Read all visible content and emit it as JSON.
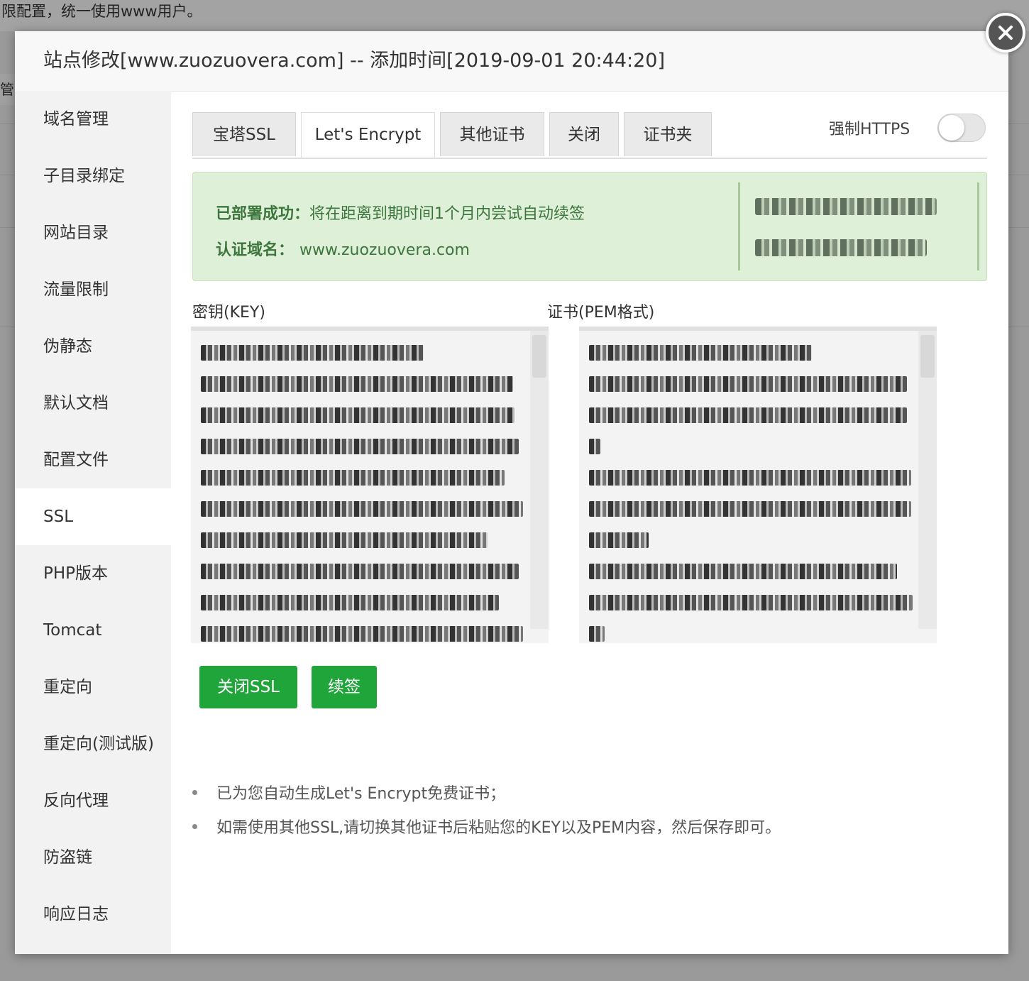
{
  "background": {
    "top_text": "限配置，统一使用www用户。",
    "left_fragment": "管"
  },
  "modal": {
    "title": "站点修改[www.zuozuovera.com] -- 添加时间[2019-09-01 20:44:20]",
    "close_icon": "close-icon"
  },
  "sidebar": {
    "items": [
      {
        "label": "域名管理"
      },
      {
        "label": "子目录绑定"
      },
      {
        "label": "网站目录"
      },
      {
        "label": "流量限制"
      },
      {
        "label": "伪静态"
      },
      {
        "label": "默认文档"
      },
      {
        "label": "配置文件"
      },
      {
        "label": "SSL",
        "active": true
      },
      {
        "label": "PHP版本"
      },
      {
        "label": "Tomcat"
      },
      {
        "label": "重定向"
      },
      {
        "label": "重定向(测试版)"
      },
      {
        "label": "反向代理"
      },
      {
        "label": "防盗链"
      },
      {
        "label": "响应日志"
      }
    ]
  },
  "tabs": [
    {
      "label": "宝塔SSL"
    },
    {
      "label": "Let's Encrypt",
      "active": true
    },
    {
      "label": "其他证书"
    },
    {
      "label": "关闭"
    },
    {
      "label": "证书夹"
    }
  ],
  "force_https": {
    "label": "强制HTTPS",
    "enabled": false
  },
  "status": {
    "deployed_label": "已部署成功：",
    "deployed_text": "将在距离到期时间1个月内尝试自动续签",
    "domain_label": "认证域名：",
    "domain_value": "www.zuozuovera.com"
  },
  "key_field": {
    "label": "密钥(KEY)"
  },
  "cert_field": {
    "label": "证书(PEM格式)"
  },
  "buttons": {
    "close_ssl": "关闭SSL",
    "renew": "续签"
  },
  "notes": [
    "已为您自动生成Let's Encrypt免费证书；",
    "如需使用其他SSL,请切换其他证书后粘贴您的KEY以及PEM内容，然后保存即可。"
  ],
  "colors": {
    "primary_green": "#20a53a",
    "alert_bg": "#dff0d8",
    "alert_text": "#3c763d"
  }
}
